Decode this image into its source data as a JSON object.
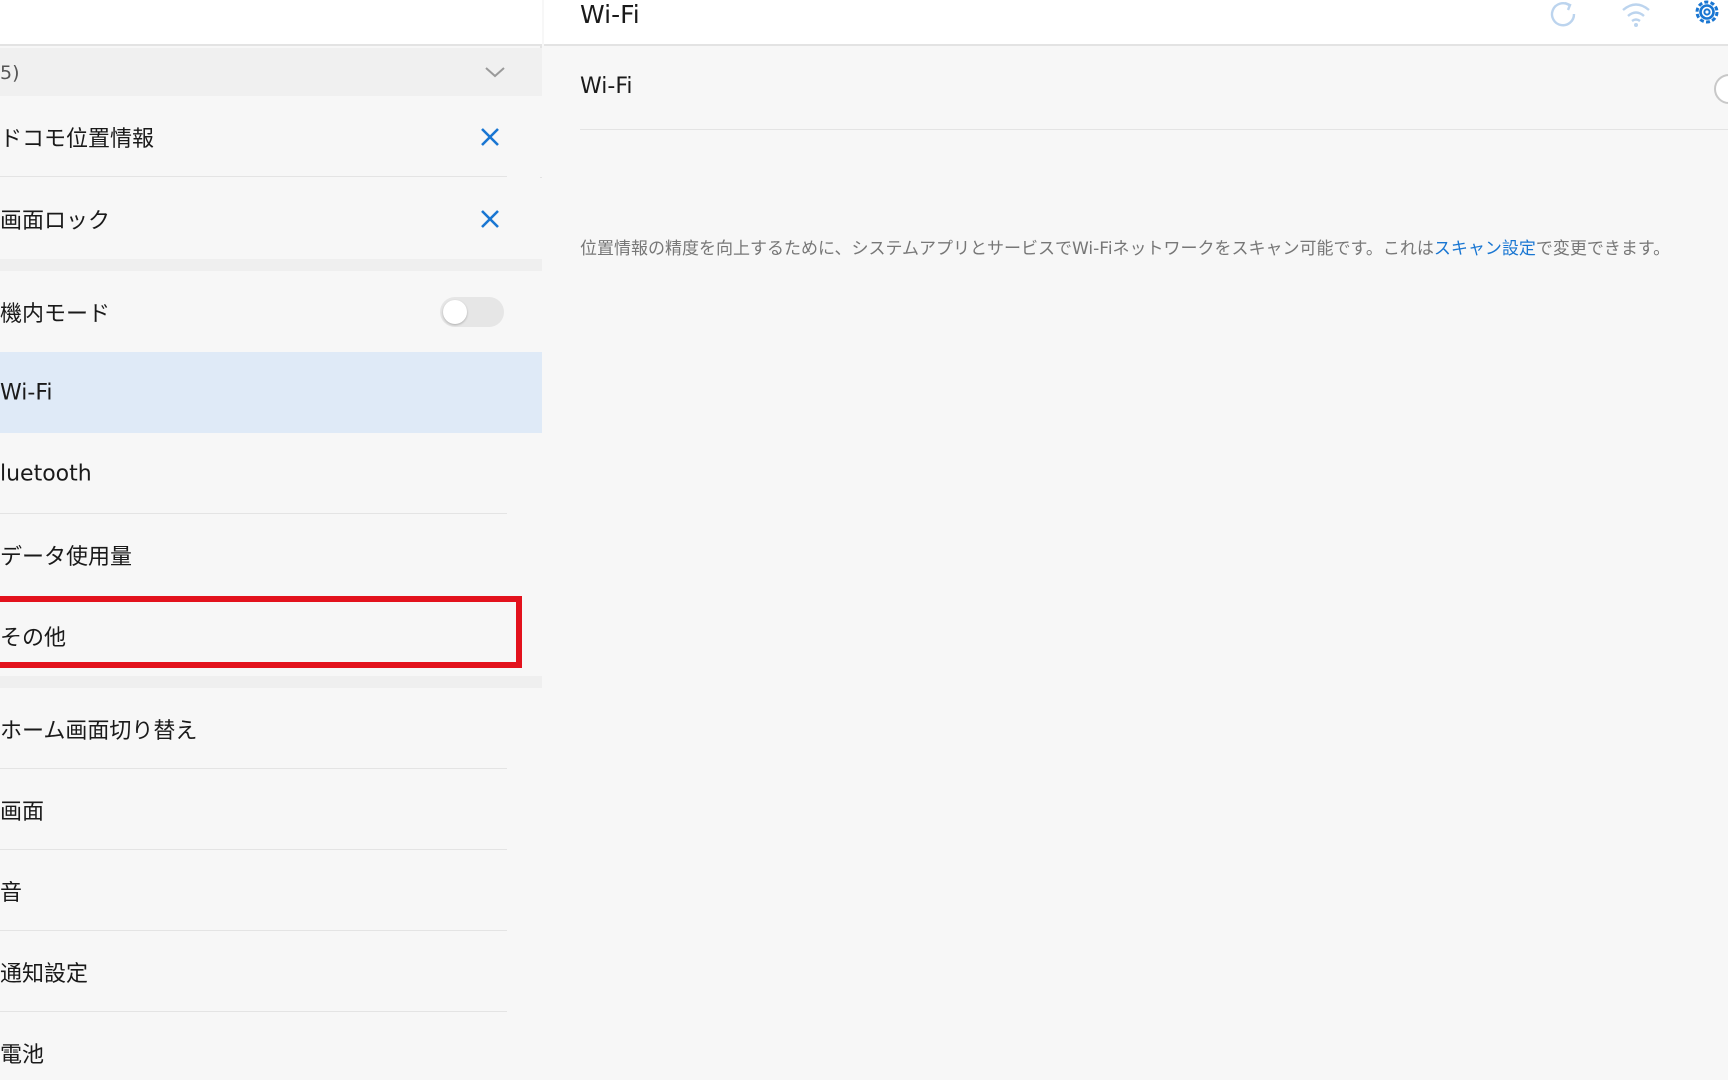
{
  "left_panel": {
    "group_header": "5)",
    "rows": {
      "docomo_location": "ドコモ位置情報",
      "screen_lock": "画面ロック",
      "airplane_mode": "機内モード",
      "wifi": "Wi-Fi",
      "bluetooth": "luetooth",
      "data_usage": "データ使用量",
      "other": "その他",
      "home_switch": "ホーム画面切り替え",
      "display": "画面",
      "sound": "音",
      "notifications": "通知設定",
      "battery": "電池"
    },
    "airplane_mode_on": false,
    "selected_row": "Wi-Fi",
    "highlighted_row": "その他",
    "highlight_color": "#e3121d",
    "accent_color": "#1976d2"
  },
  "right_panel": {
    "title": "Wi-Fi",
    "toolbar_icons": [
      "refresh-icon",
      "wifi-signal-icon",
      "settings-gear-icon"
    ],
    "wifi_row_label": "Wi-Fi",
    "note_before": "位置情報の精度を向上するために、システムアプリとサービスでWi-Fiネットワークをスキャン可能です。これは",
    "note_link": "スキャン設定",
    "note_after": "で変更できます。"
  }
}
